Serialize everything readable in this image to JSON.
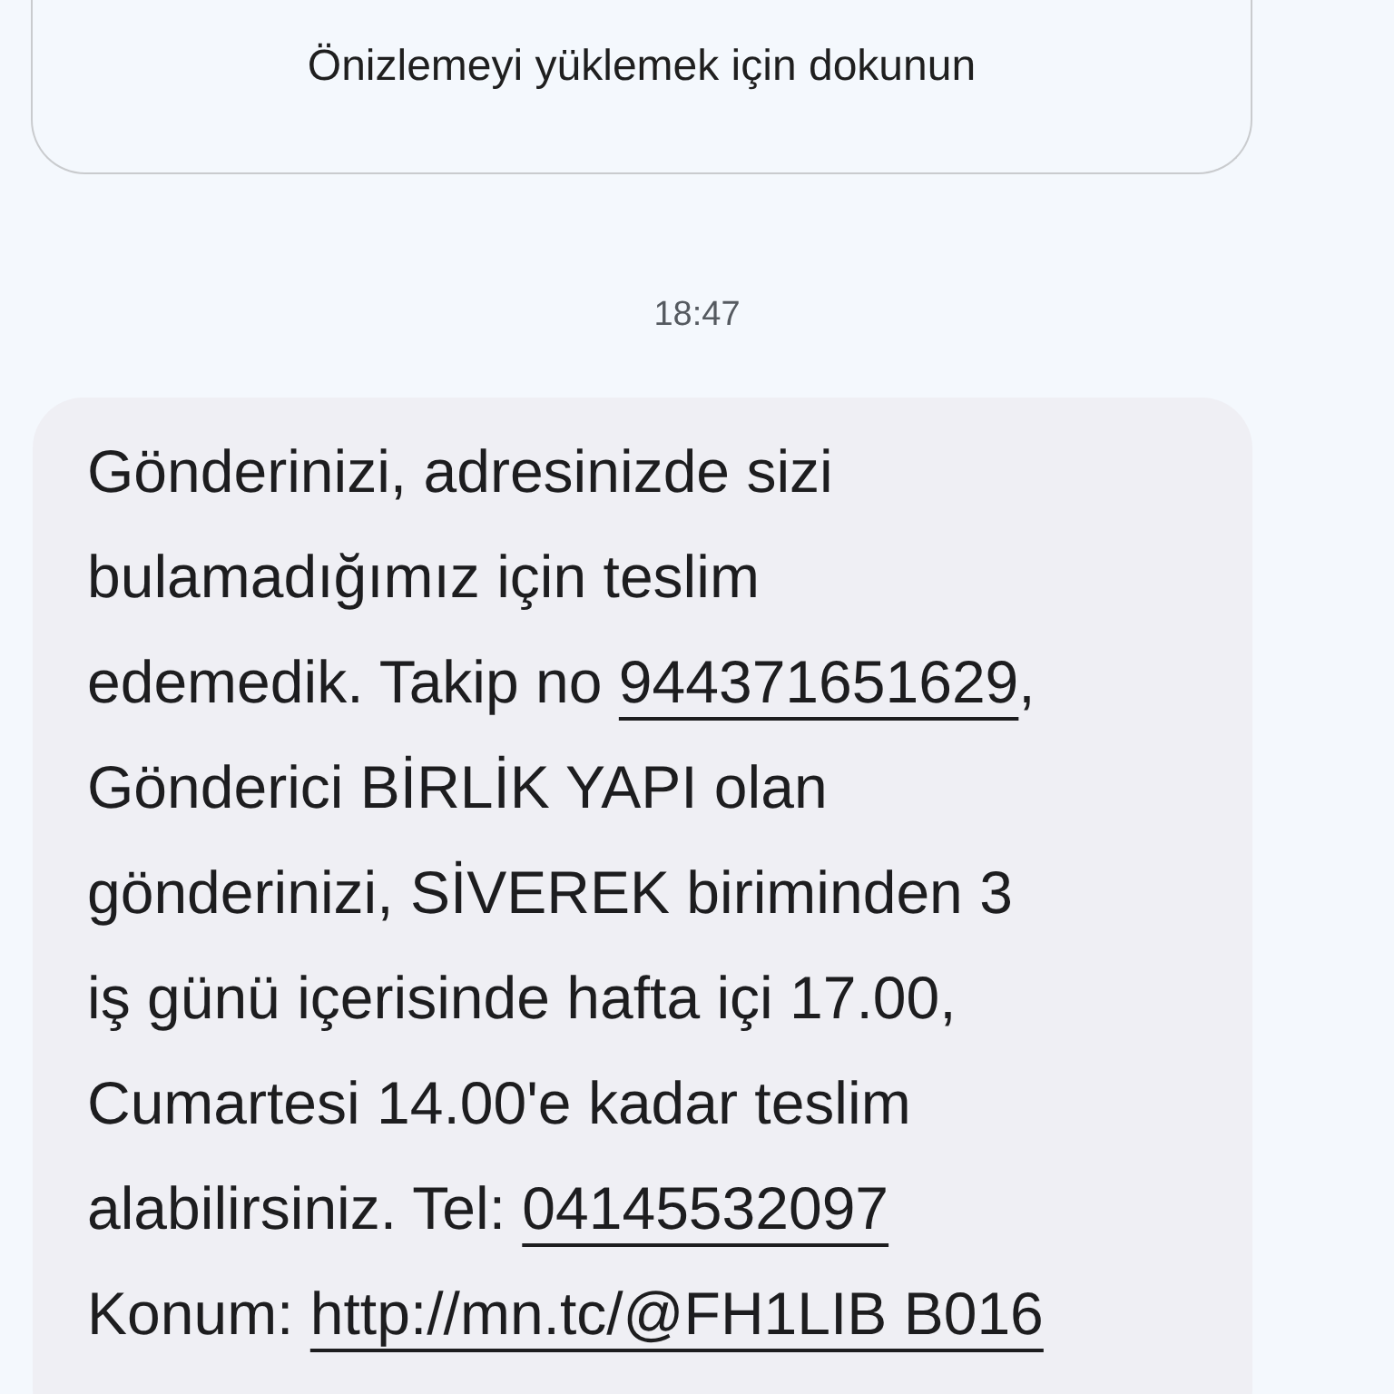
{
  "preview_card": {
    "label": "Önizlemeyi yüklemek için dokunun"
  },
  "timestamp": "18:47",
  "message": {
    "lines": [
      [
        {
          "kind": "text",
          "text": "Gönderinizi, adresinizde sizi"
        }
      ],
      [
        {
          "kind": "text",
          "text": "bulamadığımız için teslim"
        }
      ],
      [
        {
          "kind": "text",
          "text": "edemedik. Takip no "
        },
        {
          "kind": "link",
          "text": "944371651629"
        },
        {
          "kind": "text",
          "text": ","
        }
      ],
      [
        {
          "kind": "text",
          "text": "Gönderici BİRLİK YAPI olan"
        }
      ],
      [
        {
          "kind": "text",
          "text": "gönderinizi, SİVEREK biriminden 3"
        }
      ],
      [
        {
          "kind": "text",
          "text": "iş günü içerisinde hafta içi 17.00,"
        }
      ],
      [
        {
          "kind": "text",
          "text": "Cumartesi 14.00'e kadar teslim"
        }
      ],
      [
        {
          "kind": "text",
          "text": "alabilirsiniz. Tel: "
        },
        {
          "kind": "link",
          "text": "04145532097"
        }
      ],
      [
        {
          "kind": "text",
          "text": "Konum: "
        },
        {
          "kind": "link",
          "text": "http://mn.tc/@FH1LIB B016"
        }
      ]
    ]
  }
}
